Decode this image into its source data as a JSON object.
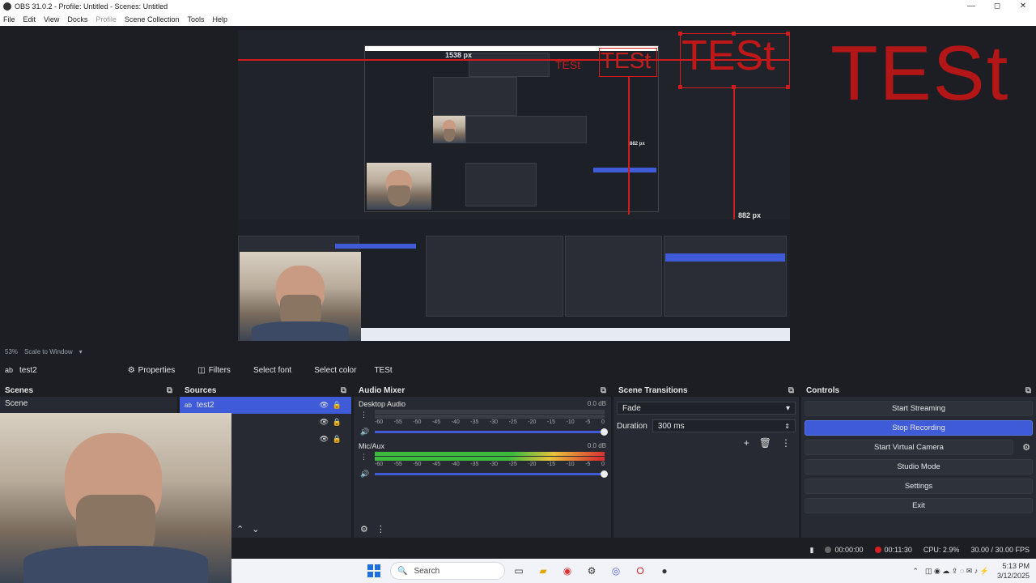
{
  "window": {
    "title": "OBS 31.0.2 - Profile: Untitled - Scenes: Untitled",
    "controls": [
      "—",
      "◻",
      "✕"
    ]
  },
  "menu": [
    "File",
    "Edit",
    "View",
    "Docks",
    "Profile",
    "Scene Collection",
    "Tools",
    "Help"
  ],
  "preview": {
    "big_text": "TESt",
    "measure_top": "1538 px",
    "measure_side": "882 px",
    "measure_inner": "882 px"
  },
  "zoom": {
    "level": "53%",
    "mode": "Scale to Window"
  },
  "context": {
    "source_name": "test2",
    "properties": "Properties",
    "filters": "Filters",
    "select_font": "Select font",
    "select_color": "Select color",
    "text_value": "TESt"
  },
  "scenes": {
    "title": "Scenes",
    "items": [
      "Scene"
    ]
  },
  "sources": {
    "title": "Sources",
    "items": [
      {
        "name": "test2",
        "selected": true
      },
      {
        "name": "",
        "selected": false
      },
      {
        "name": "",
        "selected": false
      }
    ]
  },
  "mixer": {
    "title": "Audio Mixer",
    "channels": [
      {
        "name": "Desktop Audio",
        "db": "0.0 dB"
      },
      {
        "name": "Mic/Aux",
        "db": "0.0 dB"
      }
    ],
    "scale": [
      "-60",
      "-55",
      "-50",
      "-45",
      "-40",
      "-35",
      "-30",
      "-25",
      "-20",
      "-15",
      "-10",
      "-5",
      "0"
    ]
  },
  "transitions": {
    "title": "Scene Transitions",
    "selected": "Fade",
    "duration_label": "Duration",
    "duration_value": "300 ms"
  },
  "controls": {
    "title": "Controls",
    "buttons": [
      "Start Streaming",
      "Stop Recording",
      "Start Virtual Camera",
      "Studio Mode",
      "Settings",
      "Exit"
    ]
  },
  "status": {
    "stream_time": "00:00:00",
    "rec_time": "00:11:30",
    "cpu": "CPU: 2.9%",
    "fps": "30.00 / 30.00 FPS"
  },
  "taskbar": {
    "search": "Search",
    "time": "5:13 PM",
    "date": "3/12/2025"
  }
}
